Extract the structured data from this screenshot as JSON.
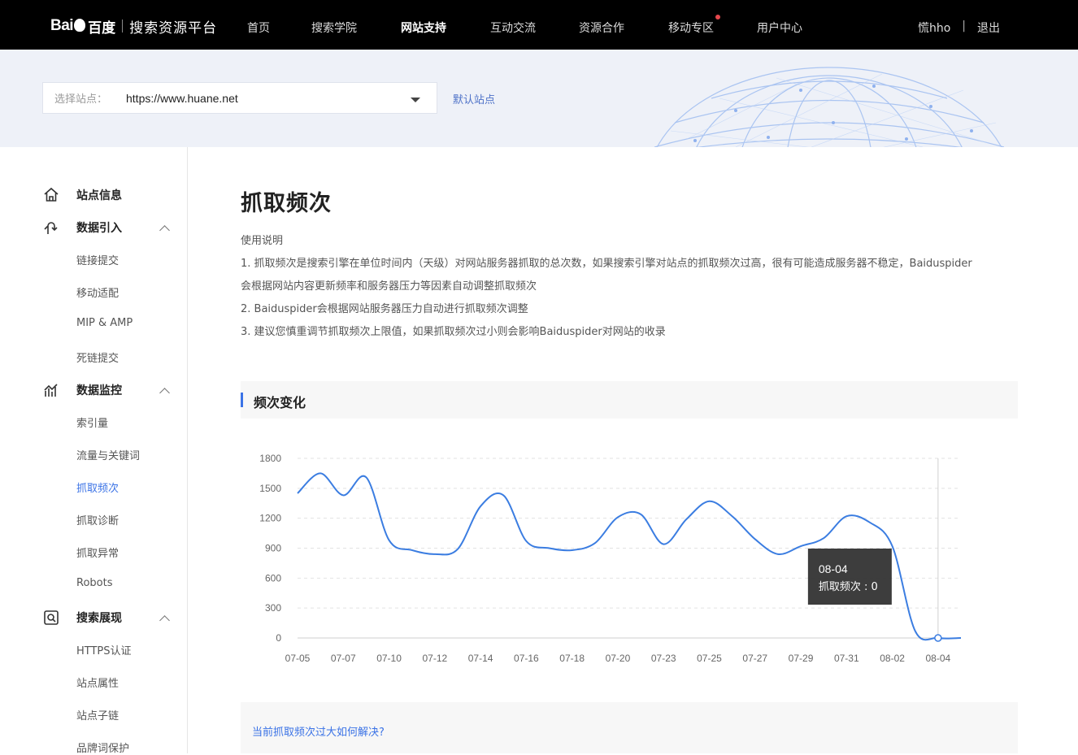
{
  "header": {
    "logo_text": "Bai",
    "logo_cn": "百度",
    "platform": "搜索资源平台",
    "nav": [
      "首页",
      "搜索学院",
      "网站支持",
      "互动交流",
      "资源合作",
      "移动专区",
      "用户中心"
    ],
    "active_nav": "网站支持",
    "username": "慌hho",
    "separator": "|",
    "logout": "退出"
  },
  "site_bar": {
    "label": "选择站点：",
    "value": "https://www.huane.net",
    "default_link": "默认站点"
  },
  "sidebar": {
    "groups": [
      {
        "label": "站点信息",
        "icon": "home-icon",
        "items": []
      },
      {
        "label": "数据引入",
        "icon": "data-import-icon",
        "items": [
          "链接提交",
          "移动适配",
          "MIP & AMP",
          "死链提交"
        ]
      },
      {
        "label": "数据监控",
        "icon": "monitor-icon",
        "items": [
          "索引量",
          "流量与关键词",
          "抓取频次",
          "抓取诊断",
          "抓取异常",
          "Robots"
        ]
      },
      {
        "label": "搜索展现",
        "icon": "search-display-icon",
        "items": [
          "HTTPS认证",
          "站点属性",
          "站点子链",
          "品牌词保护"
        ]
      }
    ],
    "active_item": "抓取频次"
  },
  "main": {
    "title": "抓取频次",
    "usage_title": "使用说明",
    "lines": [
      "1. 抓取频次是搜索引擎在单位时间内（天级）对网站服务器抓取的总次数，如果搜索引擎对站点的抓取频次过高，很有可能造成服务器不稳定，Baiduspider",
      "会根据网站内容更新频率和服务器压力等因素自动调整抓取频次",
      "2. Baiduspider会根据网站服务器压力自动进行抓取频次调整",
      "3. 建议您慎重调节抓取频次上限值，如果抓取频次过小则会影响Baiduspider对网站的收录"
    ],
    "section_title": "频次变化",
    "faq_link": "当前抓取频次过大如何解决?"
  },
  "chart_data": {
    "type": "line",
    "series": [
      {
        "name": "抓取频次",
        "values": [
          1450,
          1650,
          1430,
          1610,
          980,
          880,
          840,
          890,
          1320,
          1430,
          970,
          900,
          880,
          950,
          1210,
          1240,
          940,
          1190,
          1370,
          1220,
          990,
          840,
          920,
          1000,
          1220,
          1160,
          920,
          70,
          0,
          0
        ]
      }
    ],
    "x": [
      "07-05",
      "07-06",
      "07-07",
      "07-08",
      "07-10",
      "07-11",
      "07-12",
      "07-13",
      "07-14",
      "07-15",
      "07-16",
      "07-17",
      "07-18",
      "07-19",
      "07-20",
      "07-22",
      "07-23",
      "07-24",
      "07-25",
      "07-26",
      "07-27",
      "07-28",
      "07-29",
      "07-30",
      "07-31",
      "08-01",
      "08-02",
      "08-03",
      "08-04",
      "08-05"
    ],
    "x_tick_labels": [
      "07-05",
      "07-07",
      "07-10",
      "07-12",
      "07-14",
      "07-16",
      "07-18",
      "07-20",
      "07-23",
      "07-25",
      "07-27",
      "07-29",
      "07-31",
      "08-02",
      "08-04"
    ],
    "y_ticks": [
      0,
      300,
      600,
      900,
      1200,
      1500,
      1800
    ],
    "ylim": [
      0,
      1800
    ],
    "grid": true,
    "color": "#3b7de1",
    "tooltip": {
      "date": "08-04",
      "label": "抓取频次 : 0"
    }
  }
}
